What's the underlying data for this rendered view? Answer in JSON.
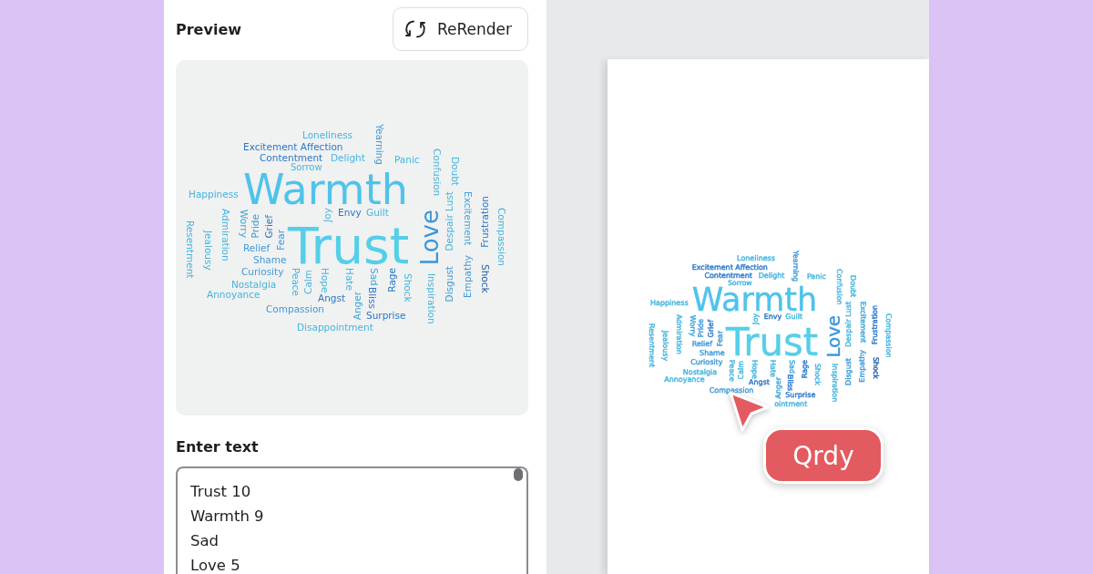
{
  "panel": {
    "preview_title": "Preview",
    "rerender_button": "ReRender",
    "input_label": "Enter text",
    "input_lines": [
      "Trust 10",
      "Warmth 9",
      "Sad",
      "Love 5"
    ]
  },
  "preview_words": [
    {
      "text": "Loneliness",
      "kind": "horizontal",
      "color": "#45b5e0"
    },
    {
      "text": "Excitement Affection",
      "kind": "horizontal",
      "color": "#2a78c8"
    },
    {
      "text": "Contentment",
      "kind": "horizontal",
      "color": "#2a78c8"
    },
    {
      "text": "Delight",
      "kind": "horizontal",
      "color": "#45b5e0"
    },
    {
      "text": "Sorrow",
      "kind": "horizontal",
      "color": "#45b5e0"
    },
    {
      "text": "Panic",
      "kind": "horizontal",
      "color": "#45b5e0"
    },
    {
      "text": "Yearning",
      "kind": "down",
      "color": "#3f9ad9"
    },
    {
      "text": "Confusion",
      "kind": "down",
      "color": "#45b5e0"
    },
    {
      "text": "Doubt",
      "kind": "down",
      "color": "#45b5e0"
    },
    {
      "text": "Happiness",
      "kind": "horizontal",
      "color": "#45b5e0"
    },
    {
      "text": "Warmth",
      "kind": "horizontal",
      "color": "#4fc3ea"
    },
    {
      "text": "Admiration",
      "kind": "down",
      "color": "#45b5e0"
    },
    {
      "text": "Worry",
      "kind": "down",
      "color": "#3fa6dc"
    },
    {
      "text": "Resentment",
      "kind": "down",
      "color": "#45b5e0"
    },
    {
      "text": "Jealousy",
      "kind": "down",
      "color": "#45b5e0"
    },
    {
      "text": "Pride",
      "kind": "up",
      "color": "#3f9ad9"
    },
    {
      "text": "Grief",
      "kind": "up",
      "color": "#2a78c8"
    },
    {
      "text": "Fear",
      "kind": "up",
      "color": "#3f9ad9"
    },
    {
      "text": "Relief",
      "kind": "horizontal",
      "color": "#3f9ad9"
    },
    {
      "text": "Shame",
      "kind": "horizontal",
      "color": "#3f9ad9"
    },
    {
      "text": "Curiosity",
      "kind": "horizontal",
      "color": "#3f9ad9"
    },
    {
      "text": "Nostalgia",
      "kind": "horizontal",
      "color": "#45b5e0"
    },
    {
      "text": "Annoyance",
      "kind": "horizontal",
      "color": "#45b5e0"
    },
    {
      "text": "Joy",
      "kind": "up",
      "color": "#45b5e0"
    },
    {
      "text": "Envy",
      "kind": "horizontal",
      "color": "#2a78c8"
    },
    {
      "text": "Guilt",
      "kind": "horizontal",
      "color": "#45b5e0"
    },
    {
      "text": "Trust",
      "kind": "horizontal",
      "color": "#55cfe9"
    },
    {
      "text": "Love",
      "kind": "up",
      "color": "#3a96dc"
    },
    {
      "text": "Peace",
      "kind": "down",
      "color": "#45b5e0"
    },
    {
      "text": "Calm",
      "kind": "up",
      "color": "#45b5e0"
    },
    {
      "text": "Hope",
      "kind": "down",
      "color": "#45b5e0"
    },
    {
      "text": "Hate",
      "kind": "down",
      "color": "#45b5e0"
    },
    {
      "text": "Sad",
      "kind": "down",
      "color": "#3fa6dc"
    },
    {
      "text": "Angst",
      "kind": "horizontal",
      "color": "#2a78c8"
    },
    {
      "text": "Anger",
      "kind": "up",
      "color": "#3fa6dc"
    },
    {
      "text": "Bliss",
      "kind": "down",
      "color": "#2a78c8"
    },
    {
      "text": "Rage",
      "kind": "up",
      "color": "#2a78c8"
    },
    {
      "text": "Shock",
      "kind": "down",
      "color": "#45b5e0"
    },
    {
      "text": "Surprise",
      "kind": "horizontal",
      "color": "#2a78c8"
    },
    {
      "text": "Compassion",
      "kind": "horizontal",
      "color": "#3f9ad9"
    },
    {
      "text": "Disappointment",
      "kind": "horizontal",
      "color": "#45b5e0"
    },
    {
      "text": "Inspiration",
      "kind": "down",
      "color": "#45b5e0"
    },
    {
      "text": "Disgust",
      "kind": "up",
      "color": "#3f9ad9"
    },
    {
      "text": "Despair Lust",
      "kind": "up",
      "color": "#45b5e0"
    },
    {
      "text": "Excitement",
      "kind": "down",
      "color": "#3fa6dc"
    },
    {
      "text": "Empathy",
      "kind": "up",
      "color": "#3f9ad9"
    },
    {
      "text": "Shock",
      "kind": "down",
      "color": "#1f5fa8"
    },
    {
      "text": "Frustration",
      "kind": "up",
      "color": "#2a78c8"
    },
    {
      "text": "Compassion",
      "kind": "down",
      "color": "#45b5e0"
    }
  ],
  "canvas_words": [
    {
      "text": "Loneliness",
      "kind": "horizontal",
      "color": "#45b5e0"
    },
    {
      "text": "Excitement Affection",
      "kind": "horizontal",
      "color": "#2a78c8"
    },
    {
      "text": "Contentment",
      "kind": "horizontal",
      "color": "#2a78c8"
    },
    {
      "text": "Delight",
      "kind": "horizontal",
      "color": "#45b5e0"
    },
    {
      "text": "Sorrow",
      "kind": "horizontal",
      "color": "#45b5e0"
    },
    {
      "text": "Panic",
      "kind": "horizontal",
      "color": "#45b5e0"
    },
    {
      "text": "Yearning",
      "kind": "down",
      "color": "#3f9ad9"
    },
    {
      "text": "Confusion",
      "kind": "down",
      "color": "#45b5e0"
    },
    {
      "text": "Doubt",
      "kind": "down",
      "color": "#45b5e0"
    },
    {
      "text": "Happiness",
      "kind": "horizontal",
      "color": "#45b5e0"
    },
    {
      "text": "Warmth",
      "kind": "horizontal",
      "color": "#4fc3ea"
    },
    {
      "text": "Admiration",
      "kind": "down",
      "color": "#45b5e0"
    },
    {
      "text": "Worry",
      "kind": "down",
      "color": "#3fa6dc"
    },
    {
      "text": "Resentment",
      "kind": "down",
      "color": "#45b5e0"
    },
    {
      "text": "Jealousy",
      "kind": "down",
      "color": "#45b5e0"
    },
    {
      "text": "Pride",
      "kind": "up",
      "color": "#3f9ad9"
    },
    {
      "text": "Grief",
      "kind": "up",
      "color": "#2a78c8"
    },
    {
      "text": "Fear",
      "kind": "up",
      "color": "#3f9ad9"
    },
    {
      "text": "Relief",
      "kind": "horizontal",
      "color": "#3f9ad9"
    },
    {
      "text": "Shame",
      "kind": "horizontal",
      "color": "#3f9ad9"
    },
    {
      "text": "Curiosity",
      "kind": "horizontal",
      "color": "#3f9ad9"
    },
    {
      "text": "Nostalgia",
      "kind": "horizontal",
      "color": "#45b5e0"
    },
    {
      "text": "Annoyance",
      "kind": "horizontal",
      "color": "#45b5e0"
    },
    {
      "text": "Joy",
      "kind": "up",
      "color": "#45b5e0"
    },
    {
      "text": "Envy",
      "kind": "horizontal",
      "color": "#2a78c8"
    },
    {
      "text": "Guilt",
      "kind": "horizontal",
      "color": "#45b5e0"
    },
    {
      "text": "Trust",
      "kind": "horizontal",
      "color": "#55cfe9"
    },
    {
      "text": "Love",
      "kind": "up",
      "color": "#3a96dc"
    },
    {
      "text": "Peace",
      "kind": "down",
      "color": "#45b5e0"
    },
    {
      "text": "Calm",
      "kind": "up",
      "color": "#45b5e0"
    },
    {
      "text": "Hope",
      "kind": "down",
      "color": "#45b5e0"
    },
    {
      "text": "Hate",
      "kind": "down",
      "color": "#45b5e0"
    },
    {
      "text": "Sad",
      "kind": "down",
      "color": "#3fa6dc"
    },
    {
      "text": "Angst",
      "kind": "horizontal",
      "color": "#2a78c8"
    },
    {
      "text": "Anger",
      "kind": "up",
      "color": "#3fa6dc"
    },
    {
      "text": "Bliss",
      "kind": "down",
      "color": "#2a78c8"
    },
    {
      "text": "Rage",
      "kind": "up",
      "color": "#2a78c8"
    },
    {
      "text": "Shock",
      "kind": "down",
      "color": "#45b5e0"
    },
    {
      "text": "Surprise",
      "kind": "horizontal",
      "color": "#2a78c8"
    },
    {
      "text": "Compassion",
      "kind": "horizontal",
      "color": "#3f9ad9"
    },
    {
      "text": "ointment",
      "kind": "horizontal",
      "color": "#45b5e0"
    },
    {
      "text": "Inspiration",
      "kind": "down",
      "color": "#45b5e0"
    },
    {
      "text": "Disgust",
      "kind": "up",
      "color": "#3f9ad9"
    },
    {
      "text": "Despair Lust",
      "kind": "up",
      "color": "#45b5e0"
    },
    {
      "text": "Excitement",
      "kind": "down",
      "color": "#3fa6dc"
    },
    {
      "text": "Empathy",
      "kind": "up",
      "color": "#3f9ad9"
    },
    {
      "text": "Shock",
      "kind": "down",
      "color": "#1f5fa8"
    },
    {
      "text": "Frustration",
      "kind": "up",
      "color": "#2a78c8"
    },
    {
      "text": "Compassion",
      "kind": "down",
      "color": "#45b5e0"
    }
  ],
  "ready_badge": "Qrdy"
}
